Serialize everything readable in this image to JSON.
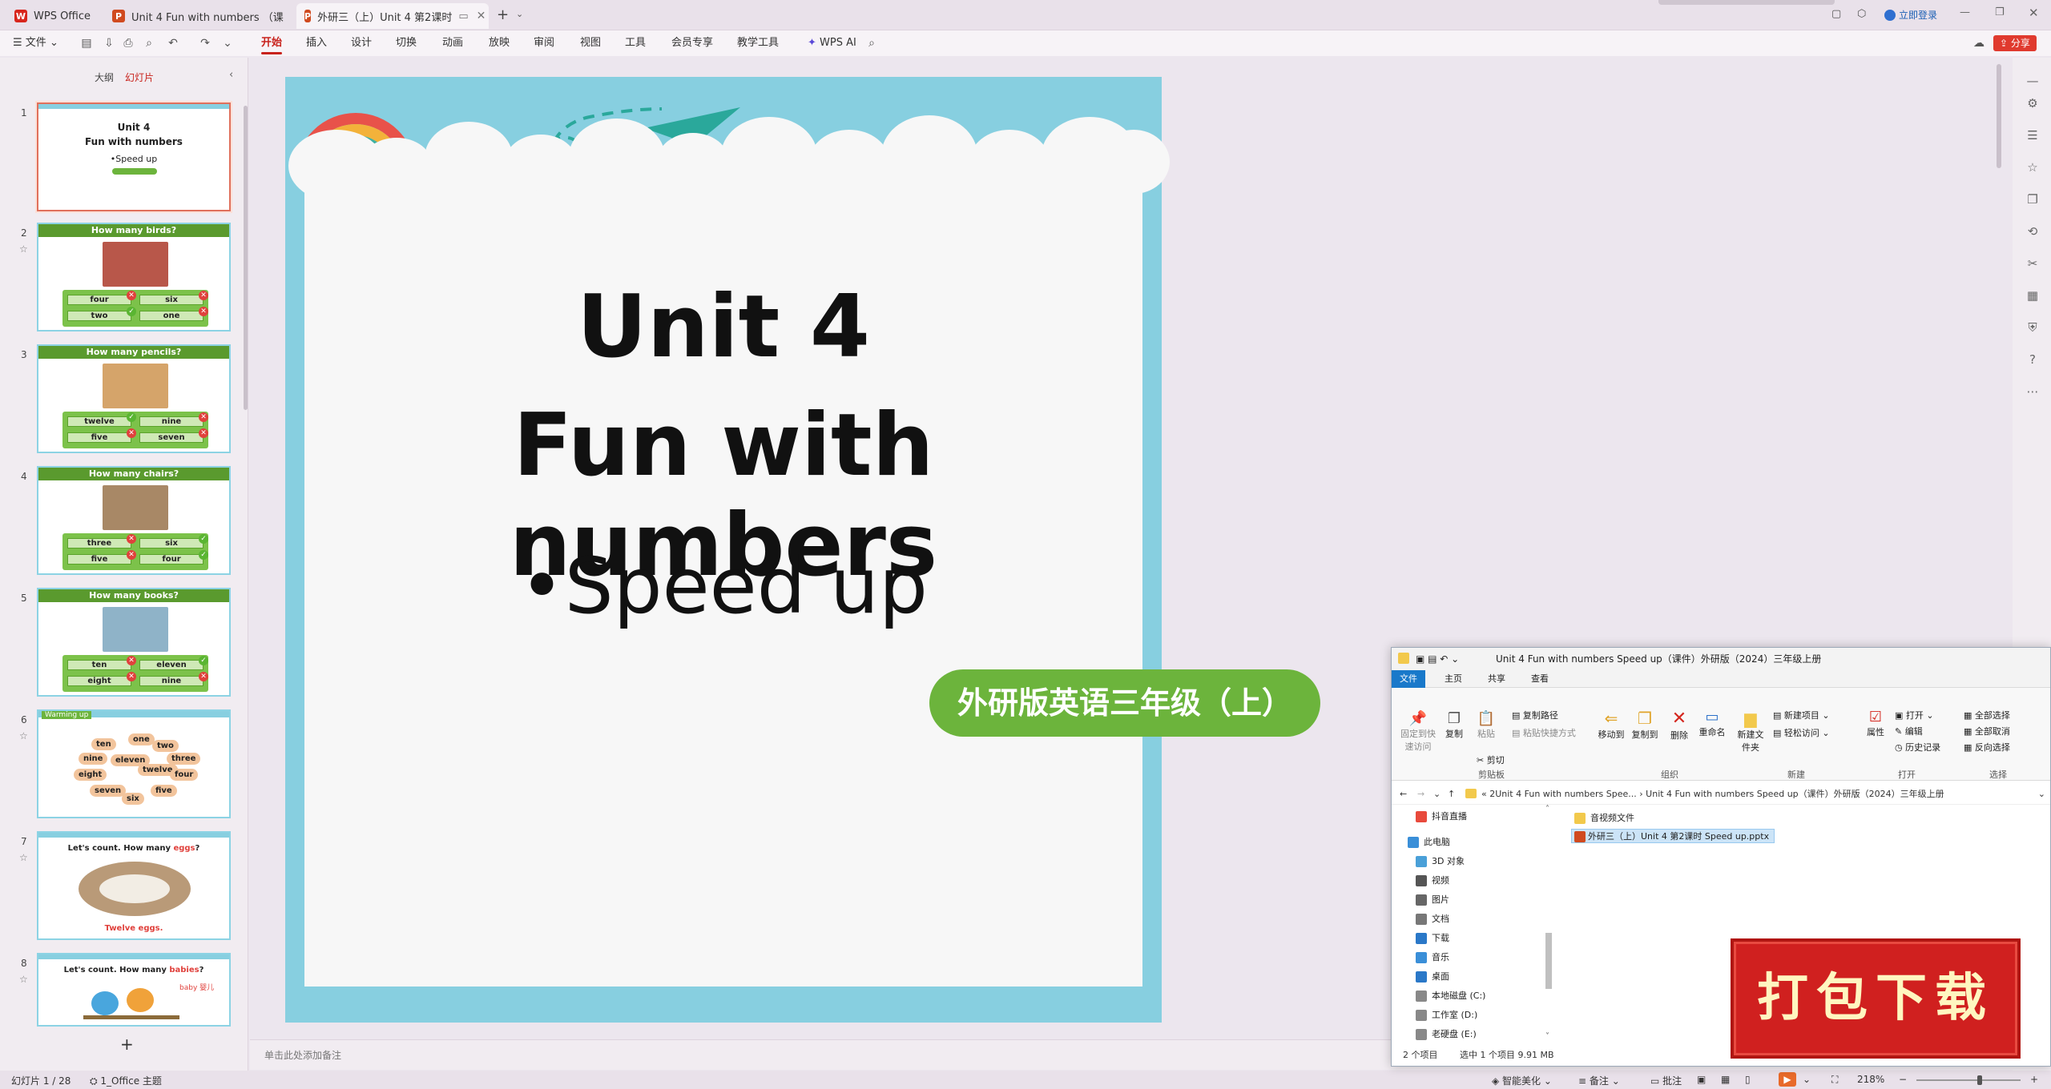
{
  "titlebar": {
    "tabs": [
      {
        "label": "WPS Office",
        "icon": "wps-logo-icon"
      },
      {
        "label": "Unit 4 Fun with numbers （课件+",
        "icon": "ppt-icon"
      },
      {
        "label": "外研三（上）Unit 4 第2课时",
        "icon": "ppt-icon"
      }
    ],
    "login": "立即登录"
  },
  "menubar": {
    "file": "文件",
    "items": [
      "开始",
      "插入",
      "设计",
      "切换",
      "动画",
      "放映",
      "审阅",
      "视图",
      "工具",
      "会员专享",
      "教学工具",
      "WPS AI"
    ],
    "active": "开始",
    "share": "分享"
  },
  "leftpanel": {
    "tabs": [
      "大纲",
      "幻灯片"
    ],
    "active_tab": "幻灯片",
    "slides": [
      {
        "num": "1",
        "title1": "Unit 4",
        "title2": "Fun with numbers",
        "sub": "•Speed up"
      },
      {
        "num": "2",
        "header": "How many birds?",
        "options": [
          "four",
          "six",
          "two",
          "one"
        ]
      },
      {
        "num": "3",
        "header": "How many pencils?",
        "options": [
          "twelve",
          "nine",
          "five",
          "seven"
        ]
      },
      {
        "num": "4",
        "header": "How many chairs?",
        "options": [
          "three",
          "six",
          "five",
          "four"
        ]
      },
      {
        "num": "5",
        "header": "How many books?",
        "options": [
          "ten",
          "eleven",
          "eight",
          "nine"
        ]
      },
      {
        "num": "6",
        "header": "Warming up",
        "words": [
          "ten",
          "one",
          "two",
          "nine",
          "eleven",
          "three",
          "eight",
          "twelve",
          "four",
          "seven",
          "five",
          "six"
        ]
      },
      {
        "num": "7",
        "header_pre": "Let's count.  How many ",
        "header_hl": "eggs",
        "footer": "Twelve eggs."
      },
      {
        "num": "8",
        "header_pre": "Let's count.  How many ",
        "header_hl": "babies",
        "extra": "baby 婴儿"
      }
    ],
    "add": "+"
  },
  "slide": {
    "title1": "Unit 4",
    "title2": "Fun with numbers",
    "subtitle": "•Speed up",
    "badge": "外研版英语三年级（上）"
  },
  "notes": {
    "placeholder": "单击此处添加备注"
  },
  "statusbar": {
    "slide_count": "幻灯片 1 / 28",
    "theme": "1_Office 主题",
    "beautify": "智能美化",
    "notes": "备注",
    "comments": "批注",
    "zoom": "218%"
  },
  "explorer": {
    "title": "Unit 4 Fun with numbers Speed up（课件）外研版（2024）三年级上册",
    "tabs": [
      "文件",
      "主页",
      "共享",
      "查看"
    ],
    "ribbon": {
      "clipboard": [
        "固定到快速访问",
        "复制",
        "粘贴",
        "复制路径",
        "粘贴快捷方式",
        "剪切"
      ],
      "organize": [
        "移动到",
        "复制到",
        "删除",
        "重命名"
      ],
      "new": [
        "新建文件夹",
        "新建项目",
        "轻松访问"
      ],
      "open": [
        "属性",
        "打开",
        "编辑",
        "历史记录"
      ],
      "select": [
        "全部选择",
        "全部取消",
        "反向选择"
      ],
      "groups": [
        "剪贴板",
        "组织",
        "新建",
        "打开",
        "选择"
      ]
    },
    "address": [
      "2Unit 4 Fun with numbers Spee...",
      "Unit 4 Fun with numbers Speed up（课件）外研版（2024）三年级上册"
    ],
    "nav": [
      "抖音直播",
      "此电脑",
      "3D 对象",
      "视频",
      "图片",
      "文档",
      "下载",
      "音乐",
      "桌面",
      "本地磁盘 (C:)",
      "工作室 (D:)",
      "老硬盘 (E:)"
    ],
    "files": [
      "音视频文件",
      "外研三（上）Unit 4 第2课时 Speed up.pptx"
    ],
    "status": [
      "2 个项目",
      "选中 1 个项目  9.91 MB"
    ]
  },
  "stamp": {
    "label": "打包下载"
  },
  "colors": {
    "accent": "#c8221c",
    "slide_bg": "#87cfe0",
    "badge": "#6cb43c",
    "stamp": "#d0201f"
  }
}
